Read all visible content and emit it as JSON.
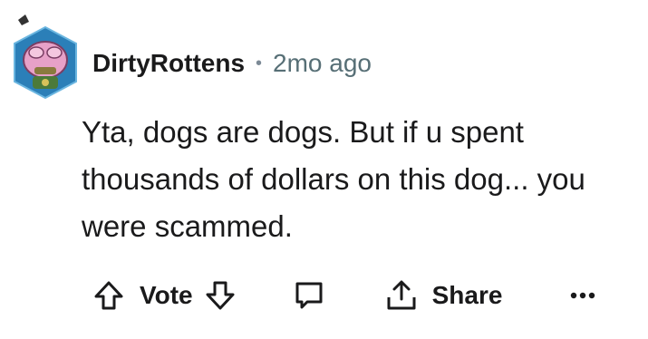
{
  "comment": {
    "author": "DirtyRottens",
    "separator": "•",
    "time": "2mo ago",
    "body": "Yta, dogs are dogs. But if u spent thousands of dollars on this dog... you were scammed."
  },
  "actions": {
    "vote_label": "Vote",
    "share_label": "Share",
    "more_label": "•••"
  },
  "icons": {
    "upvote": "arrow-up-icon",
    "downvote": "arrow-down-icon",
    "reply": "comment-bubble-icon",
    "share": "share-icon",
    "more": "more-options-icon"
  },
  "colors": {
    "text": "#1a1a1b",
    "meta": "#576f76",
    "avatar_bg": "#2b7fb8",
    "avatar_fill": "#e7a1c8"
  }
}
